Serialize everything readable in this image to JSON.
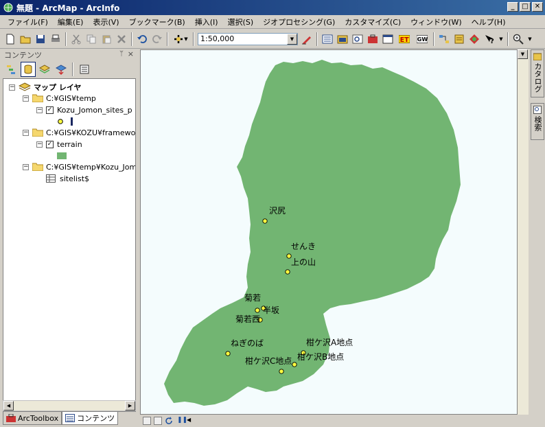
{
  "window": {
    "title": "無題 - ArcMap - ArcInfo"
  },
  "menu": [
    "ファイル(F)",
    "編集(E)",
    "表示(V)",
    "ブックマーク(B)",
    "挿入(I)",
    "選択(S)",
    "ジオプロセシング(G)",
    "カスタマイズ(C)",
    "ウィンドウ(W)",
    "ヘルプ(H)"
  ],
  "toolbar": {
    "scale": "1:50,000"
  },
  "toc": {
    "title": "コンテンツ",
    "root": "マップ レイヤ",
    "groups": [
      {
        "folder": "C:¥GIS¥temp",
        "layer": "Kozu_Jomon_sites_p"
      },
      {
        "folder": "C:¥GIS¥KOZU¥framework",
        "layer": "terrain"
      },
      {
        "folder": "C:¥GIS¥temp¥Kozu_Jomo",
        "layer": "sitelist$"
      }
    ]
  },
  "bottom_tabs": [
    "ArcToolbox",
    "コンテンツ"
  ],
  "side_tabs": [
    "カタログ",
    "検索"
  ],
  "map": {
    "terrain_color": "#72b572",
    "point_color": "#ffff40",
    "sites": [
      "沢尻",
      "せんき",
      "上の山",
      "菊若",
      "半坂",
      "菊若西",
      "ねぎのば",
      "柑ケ沢A地点",
      "柑ケ沢B地点",
      "柑ケ沢C地点"
    ]
  }
}
